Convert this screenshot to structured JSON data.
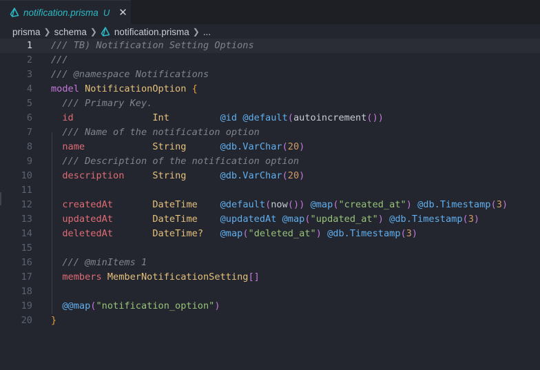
{
  "tab": {
    "title": "notification.prisma",
    "status": "U",
    "close": "✕"
  },
  "breadcrumb": {
    "items": [
      "prisma",
      "schema",
      "notification.prisma",
      "..."
    ]
  },
  "editor": {
    "current_line": 1,
    "lines": [
      {
        "n": "1",
        "text": "/// TB) Notification Setting Options"
      },
      {
        "n": "2",
        "text": "///"
      },
      {
        "n": "3",
        "text": "/// @namespace Notifications"
      },
      {
        "n": "4",
        "text": "model NotificationOption {"
      },
      {
        "n": "5",
        "text": "  /// Primary Key."
      },
      {
        "n": "6",
        "text": "  id              Int         @id @default(autoincrement())"
      },
      {
        "n": "7",
        "text": "  /// Name of the notification option"
      },
      {
        "n": "8",
        "text": "  name            String      @db.VarChar(20)"
      },
      {
        "n": "9",
        "text": "  /// Description of the notification option"
      },
      {
        "n": "10",
        "text": "  description     String      @db.VarChar(20)"
      },
      {
        "n": "11",
        "text": ""
      },
      {
        "n": "12",
        "text": "  createdAt       DateTime    @default(now()) @map(\"created_at\") @db.Timestamp(3)"
      },
      {
        "n": "13",
        "text": "  updatedAt       DateTime    @updatedAt @map(\"updated_at\") @db.Timestamp(3)"
      },
      {
        "n": "14",
        "text": "  deletedAt       DateTime?   @map(\"deleted_at\") @db.Timestamp(3)"
      },
      {
        "n": "15",
        "text": ""
      },
      {
        "n": "16",
        "text": "  /// @minItems 1"
      },
      {
        "n": "17",
        "text": "  members MemberNotificationSetting[]"
      },
      {
        "n": "18",
        "text": ""
      },
      {
        "n": "19",
        "text": "  @@map(\"notification_option\")"
      },
      {
        "n": "20",
        "text": "}"
      }
    ]
  },
  "colors": {
    "background": "#23262e",
    "tab_title": "#2bbac5",
    "comment": "#7f848e",
    "keyword": "#c678dd",
    "type": "#e5c07b",
    "field": "#e06c75",
    "attribute": "#61afef",
    "string": "#98c379",
    "number": "#d19a66"
  }
}
